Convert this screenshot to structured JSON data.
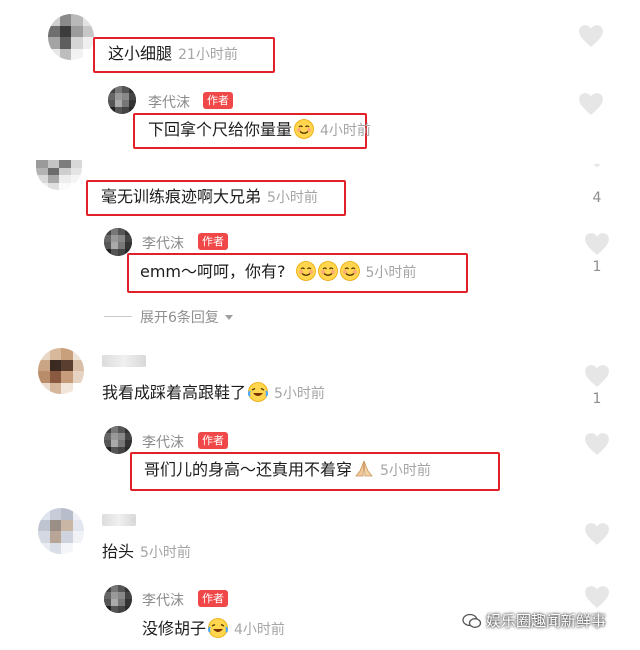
{
  "comments": [
    {
      "text": "这小细腿",
      "time": "21小时前"
    },
    {
      "text": "毫无训练痕迹啊大兄弟",
      "time": "5小时前"
    },
    {
      "text": "我看成踩着高跟鞋了",
      "time": "5小时前"
    },
    {
      "text": "抬头",
      "time": "5小时前"
    }
  ],
  "replies": [
    {
      "author": "李代沫",
      "badge": "作者",
      "text": "下回拿个尺给你量量",
      "time": "4小时前"
    },
    {
      "author": "李代沫",
      "badge": "作者",
      "text": "emm～呵呵，你有?",
      "time": "5小时前"
    },
    {
      "author": "李代沫",
      "badge": "作者",
      "text": "哥们儿的身高～还真用不着穿",
      "time": "5小时前"
    },
    {
      "author": "李代沫",
      "badge": "作者",
      "text": "没修胡子",
      "time": "4小时前"
    }
  ],
  "like_counts": {
    "c2": "4",
    "r2": "1",
    "c3": "1"
  },
  "expand_label": "展开6条回复",
  "expand_icon": "caret-down-icon",
  "watermark": "娱乐圈趣闻新鲜事",
  "colors": {
    "highlight": "#e0212a",
    "badge": "#f04848",
    "time": "#a5a5a5",
    "heart": "#e6e6e6"
  }
}
